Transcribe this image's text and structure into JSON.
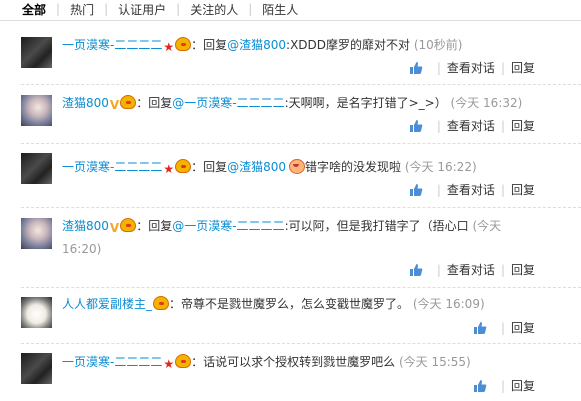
{
  "tabs": [
    "全部",
    "热门",
    "认证用户",
    "关注的人",
    "陌生人"
  ],
  "actions": {
    "view_conversation": "查看对话",
    "reply": "回复"
  },
  "comments": [
    {
      "user": "一页漠寒-二二二二",
      "pre": "：回复",
      "mention": "@渣猫800",
      "body": ":XDDD摩罗的靡对不对",
      "time": "(10秒前)"
    },
    {
      "user": "渣猫800",
      "pre": "：回复",
      "mention": "@一页漠寒-二二二二",
      "body": ":天啊啊，是名字打错了>_>）",
      "time": "(今天 16:32)"
    },
    {
      "user": "一页漠寒-二二二二",
      "pre": "：回复",
      "mention": "@渣猫800",
      "body": "错字啥的没发现啦",
      "time": "(今天 16:22)"
    },
    {
      "user": "渣猫800",
      "pre": "：回复",
      "mention": "@一页漠寒-二二二二",
      "body": ":可以阿，但是我打错字了（捂心口",
      "time_line1": "(今天",
      "time_line2": "16:20)"
    },
    {
      "user": "人人都爱副楼主_",
      "pre": "：",
      "body": "帝尊不是戮世魔罗么，怎么变戳世魔罗了。",
      "time": "(今天 16:09)"
    },
    {
      "user": "一页漠寒-二二二二",
      "pre": "：",
      "body": "话说可以求个授权转到戮世魔罗吧么",
      "time": "(今天 15:55)"
    }
  ]
}
